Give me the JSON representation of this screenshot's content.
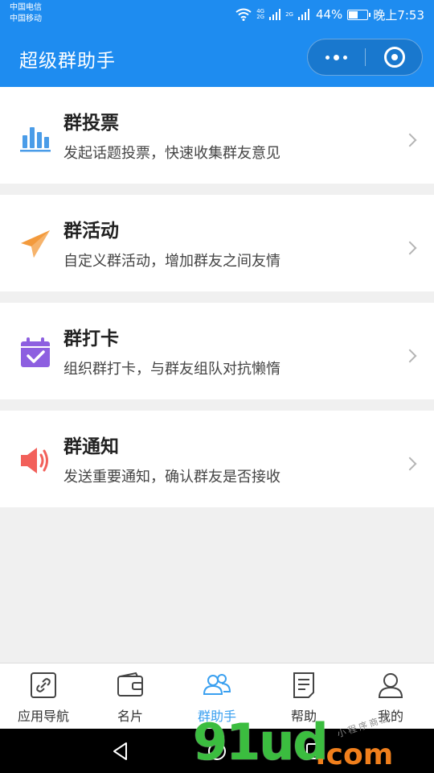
{
  "status_bar": {
    "carrier_1": "中国电信",
    "carrier_2": "中国移动",
    "net_1": "4G\n2G",
    "net_2": "2G",
    "battery": "44%",
    "battery_level": 0.44,
    "time": "晚上7:53"
  },
  "nav": {
    "title": "超级群助手",
    "more_icon": "more-dots-icon",
    "close_icon": "record-close-icon"
  },
  "menu": [
    {
      "title": "群投票",
      "desc": "发起话题投票，快速收集群友意见",
      "icon": "bar-chart-icon",
      "color": "#4a9ce8"
    },
    {
      "title": "群活动",
      "desc": "自定义群活动，增加群友之间友情",
      "icon": "paper-plane-icon",
      "color": "#f39a3c"
    },
    {
      "title": "群打卡",
      "desc": "组织群打卡，与群友组队对抗懒惰",
      "icon": "calendar-check-icon",
      "color": "#8d5fe0"
    },
    {
      "title": "群通知",
      "desc": "发送重要通知，确认群友是否接收",
      "icon": "speaker-icon",
      "color": "#f2605a"
    }
  ],
  "tabs": [
    {
      "label": "应用导航",
      "icon": "link-icon",
      "active": false
    },
    {
      "label": "名片",
      "icon": "wallet-icon",
      "active": false
    },
    {
      "label": "群助手",
      "icon": "group-users-icon",
      "active": true
    },
    {
      "label": "帮助",
      "icon": "document-icon",
      "active": false
    },
    {
      "label": "我的",
      "icon": "user-icon",
      "active": false
    }
  ],
  "colors": {
    "brand_blue": "#1e8cf0",
    "tab_active": "#3aa0f0",
    "background": "#f0f0f0"
  },
  "watermark": {
    "main": "91ud",
    "suffix": ".com",
    "small": "小程序商店"
  }
}
